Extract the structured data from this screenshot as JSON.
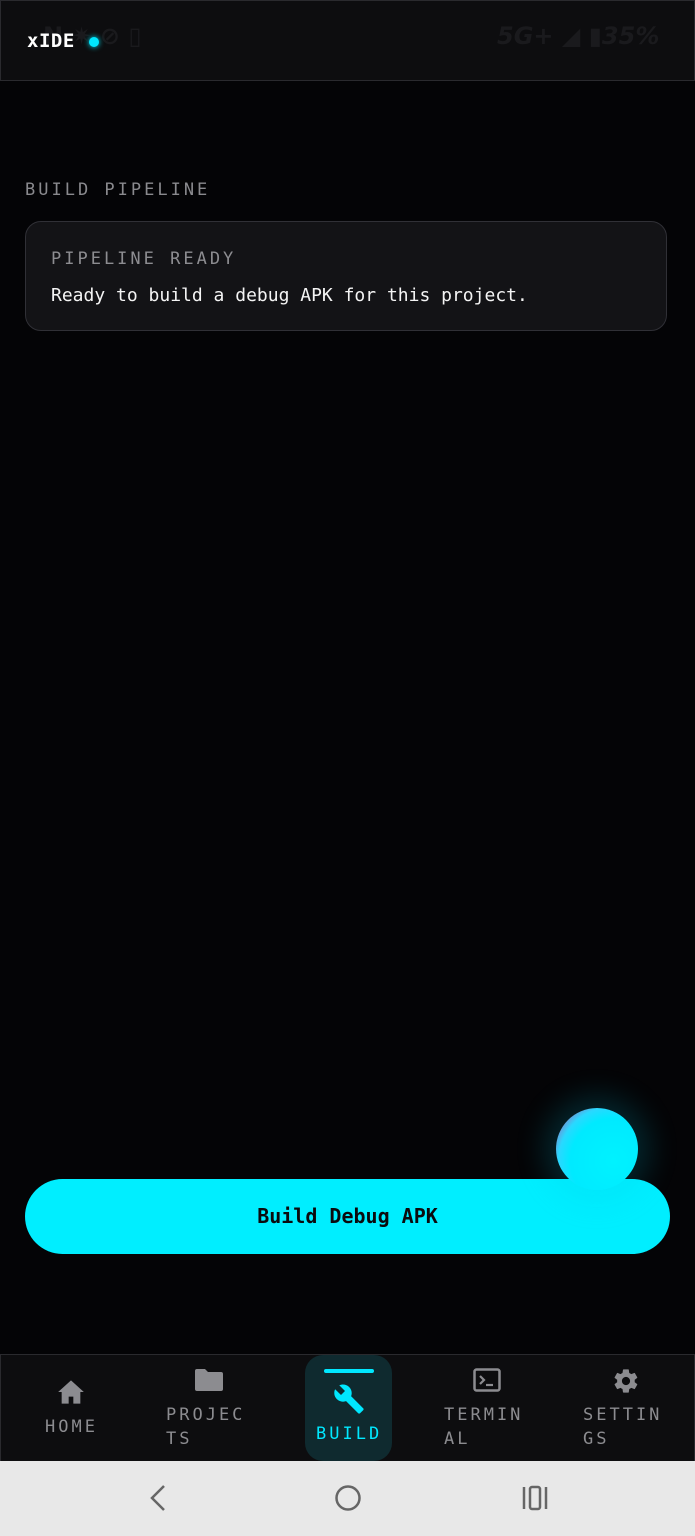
{
  "status_bar": {
    "left_icons": [
      "notification-icon",
      "brightness-icon",
      "mute-icon",
      "sim-icon"
    ],
    "network": "5G+",
    "battery": "35%"
  },
  "app": {
    "title": "xIDE",
    "accent_color": "#00e8ff"
  },
  "main": {
    "section_label": "BUILD PIPELINE",
    "card": {
      "title": "PIPELINE READY",
      "body": "Ready to build a debug APK for this project."
    },
    "build_button_label": "Build Debug APK"
  },
  "bottom_nav": {
    "items": [
      {
        "label": "HOME",
        "icon": "home-icon",
        "active": false
      },
      {
        "label": "PROJEC\nTS",
        "icon": "folder-icon",
        "active": false
      },
      {
        "label": "BUILD",
        "icon": "wrench-icon",
        "active": true
      },
      {
        "label": "TERMIN\nAL",
        "icon": "terminal-icon",
        "active": false
      },
      {
        "label": "SETTIN\nGS",
        "icon": "gear-icon",
        "active": false
      }
    ]
  },
  "system_nav": {
    "buttons": [
      "back-icon",
      "home-circle-icon",
      "recents-icon"
    ]
  }
}
